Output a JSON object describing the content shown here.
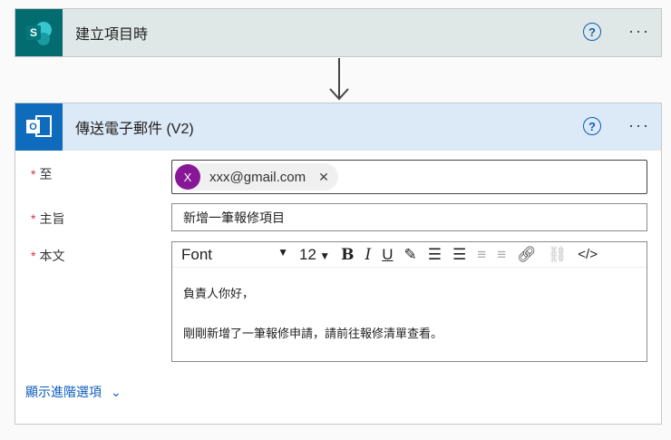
{
  "trigger": {
    "title": "建立項目時",
    "icon": "sharepoint-icon",
    "color": "#036c70"
  },
  "action": {
    "title": "傳送電子郵件 (V2)",
    "icon": "outlook-icon",
    "color": "#0f6cbd"
  },
  "help": "?",
  "more": "···",
  "fields": {
    "to": {
      "label": "至",
      "chip_initial": "X",
      "chip_email": "xxx@gmail.com",
      "remove": "✕"
    },
    "subject": {
      "label": "主旨",
      "value": "新增一筆報修項目"
    },
    "body": {
      "label": "本文",
      "font": "Font",
      "size": "12",
      "line1": "負責人你好，",
      "line2": "剛剛新增了一筆報修申請，請前往報修清單查看。"
    }
  },
  "required": "*",
  "advanced": "顯示進階選項",
  "toolbar": {
    "bold": "B",
    "italic": "I",
    "underline": "U",
    "code": "</>"
  }
}
